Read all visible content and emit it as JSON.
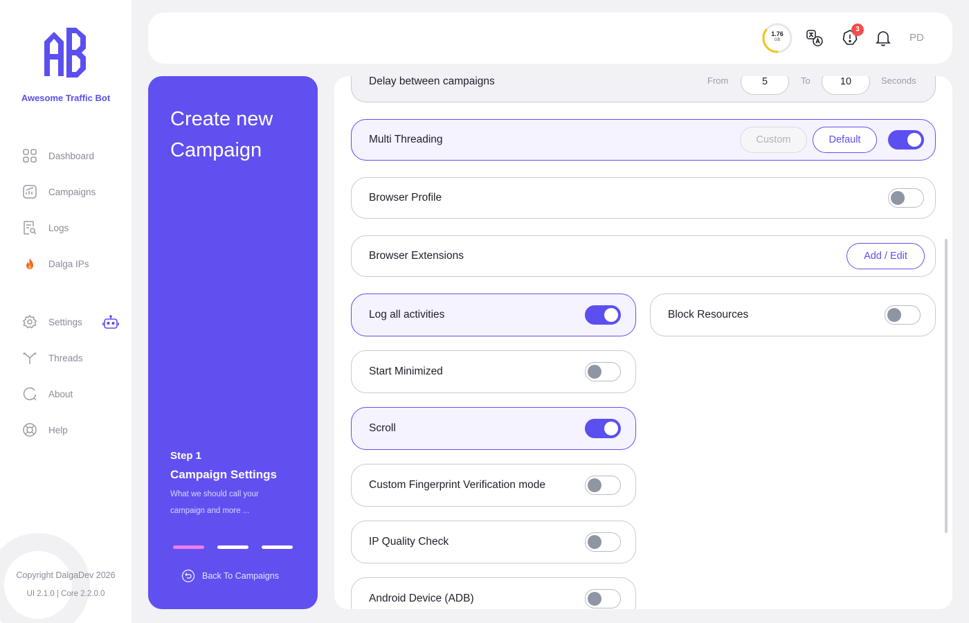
{
  "sidebar": {
    "brand": "Awesome Traffic Bot",
    "items": [
      {
        "label": "Dashboard",
        "icon": "dashboard-icon"
      },
      {
        "label": "Campaigns",
        "icon": "campaigns-icon"
      },
      {
        "label": "Logs",
        "icon": "logs-icon"
      },
      {
        "label": "Dalga IPs",
        "icon": "fire-icon"
      },
      {
        "label": "Settings",
        "icon": "gear-icon"
      },
      {
        "label": "Threads",
        "icon": "threads-icon"
      },
      {
        "label": "About",
        "icon": "about-icon"
      },
      {
        "label": "Help",
        "icon": "help-icon"
      }
    ],
    "copyright": "Copyright DalgaDev 2026",
    "version": "UI 2.1.0 | Core 2.2.0.0"
  },
  "header": {
    "ram_value": "1.76",
    "ram_unit": "GB",
    "ram_fraction": 0.35,
    "alert_count": "3",
    "avatar": "PD"
  },
  "wizard": {
    "title": "Create new Campaign",
    "step_number": "Step 1",
    "step_name": "Campaign Settings",
    "step_description": "What we should call your campaign and more ...",
    "current_step": 1,
    "total_steps": 3,
    "back_label": "Back To Campaigns"
  },
  "settings": {
    "delay": {
      "label": "Delay between campaigns",
      "from_label": "From",
      "from": "5",
      "to_label": "To",
      "to": "10",
      "unit": "Seconds"
    },
    "multi_threading": {
      "label": "Multi Threading",
      "custom_label": "Custom",
      "default_label": "Default",
      "enabled": true
    },
    "browser_profile": {
      "label": "Browser Profile",
      "enabled": false
    },
    "browser_extensions": {
      "label": "Browser Extensions",
      "button": "Add / Edit"
    },
    "log_all": {
      "label": "Log all activities",
      "enabled": true
    },
    "block_resources": {
      "label": "Block Resources",
      "enabled": false
    },
    "start_minimized": {
      "label": "Start Minimized",
      "enabled": false
    },
    "scroll": {
      "label": "Scroll",
      "enabled": true
    },
    "custom_fingerprint": {
      "label": "Custom Fingerprint Verification mode",
      "enabled": false
    },
    "ip_quality": {
      "label": "IP Quality Check",
      "enabled": false
    },
    "android_device": {
      "label": "Android Device (ADB)",
      "enabled": false
    }
  },
  "colors": {
    "accent": "#6150f0",
    "progress_active": "#f07ce6",
    "alert": "#f24d4d",
    "ram_ring": "#f5c21b"
  }
}
